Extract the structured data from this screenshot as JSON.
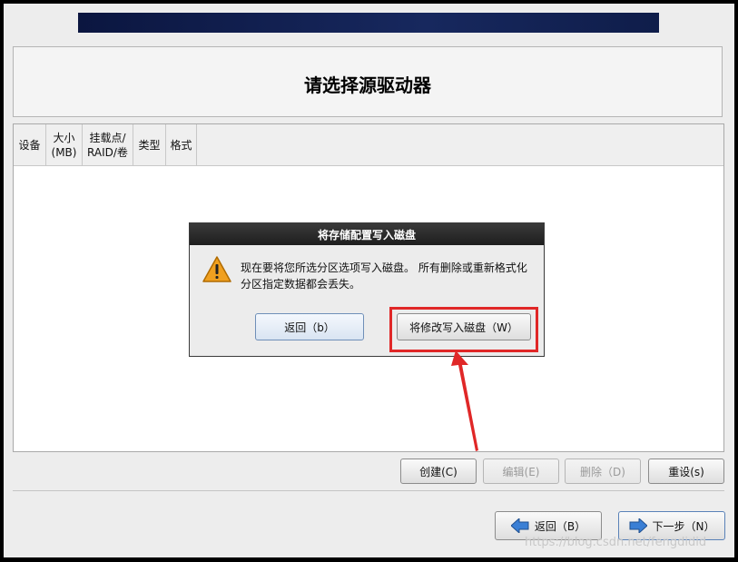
{
  "page": {
    "title": "请选择源驱动器"
  },
  "table": {
    "columns": [
      {
        "label": "设备",
        "name": "col-device"
      },
      {
        "label": "大小\n(MB)",
        "name": "col-size"
      },
      {
        "label": "挂载点/\nRAID/卷",
        "name": "col-mount"
      },
      {
        "label": "类型",
        "name": "col-type"
      },
      {
        "label": "格式",
        "name": "col-format"
      }
    ]
  },
  "actions": {
    "create": "创建(C)",
    "edit": "编辑(E)",
    "delete": "删除（D)",
    "reset": "重设(s)"
  },
  "nav": {
    "back": "返回（B）",
    "next": "下一步（N）"
  },
  "dialog": {
    "title": "将存储配置写入磁盘",
    "message": "现在要将您所选分区选项写入磁盘。 所有删除或重新格式化分区指定数据都会丢失。",
    "back_button": "返回（b）",
    "write_button": "将修改写入磁盘（W）"
  },
  "watermark": "https://blog.csdn.net/fengdidid",
  "colors": {
    "highlight": "#e02727",
    "banner": "#17285e",
    "warning": "#f0a020"
  }
}
